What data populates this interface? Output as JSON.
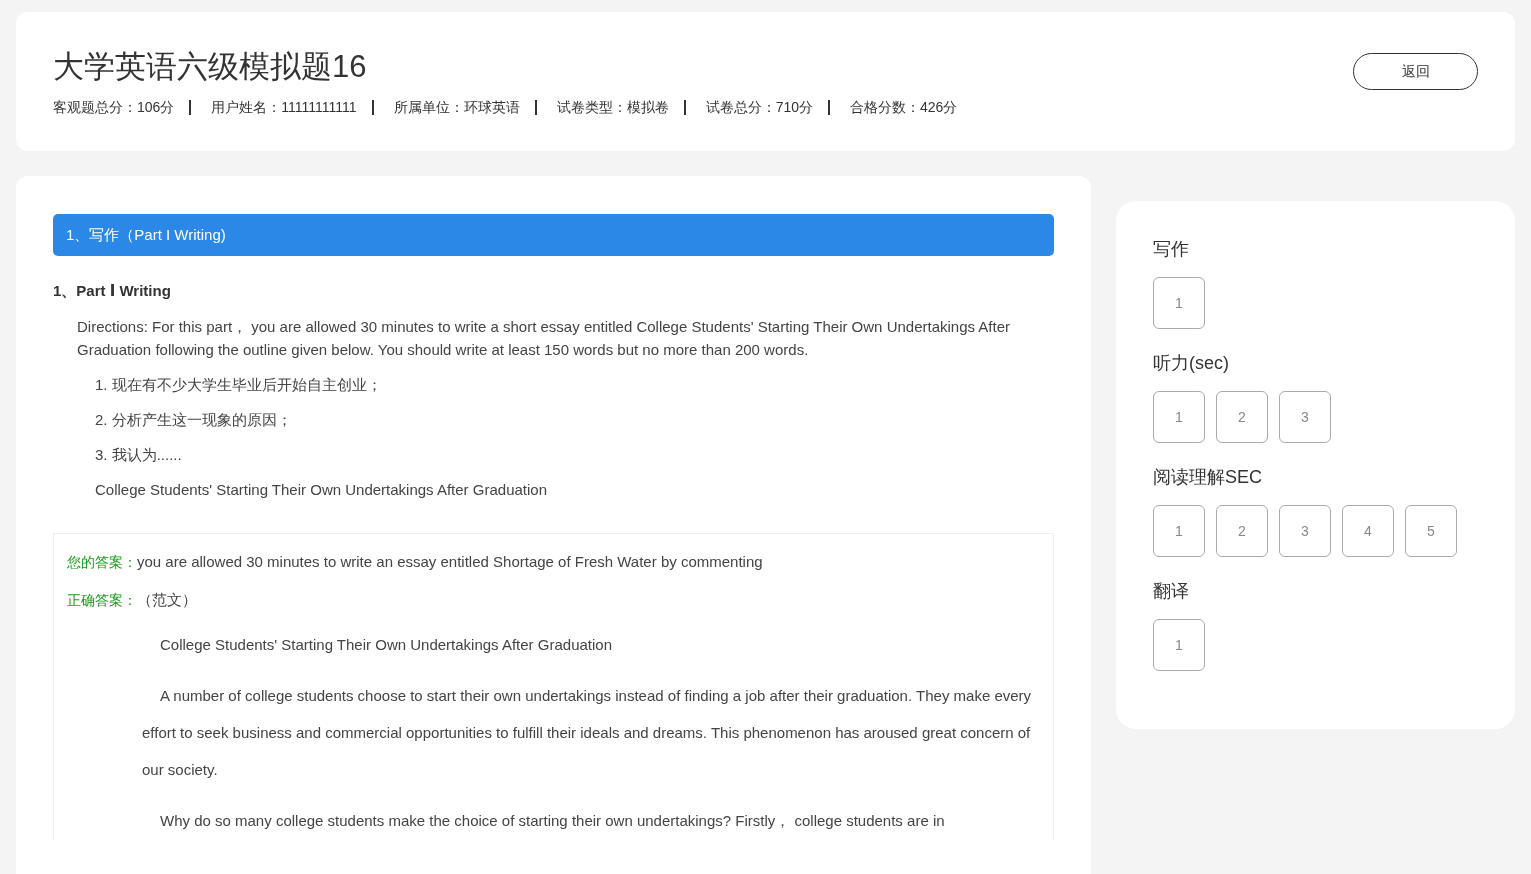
{
  "header": {
    "title": "大学英语六级模拟题16",
    "back_button": "返回",
    "info": [
      {
        "label": "客观题总分：",
        "value": "106分"
      },
      {
        "label": "用户姓名：",
        "value": "11111111111"
      },
      {
        "label": "所属单位：",
        "value": "环球英语"
      },
      {
        "label": "试卷类型：",
        "value": "模拟卷"
      },
      {
        "label": "试卷总分：",
        "value": "710分"
      },
      {
        "label": "合格分数：",
        "value": "426分"
      }
    ]
  },
  "section_bar": "1、写作（Part I Writing)",
  "question": {
    "number": "1、",
    "title": "Part Ⅰ Writing",
    "directions": "Directions: For this part， you are allowed 30 minutes to write a short essay entitled College Students' Starting Their Own Undertakings After Graduation following the outline given below. You should write at least 150 words but no more than 200 words.",
    "outline": [
      "1. 现在有不少大学生毕业后开始自主创业；",
      "2. 分析产生这一现象的原因；",
      "3. 我认为......",
      "College Students' Starting Their Own Undertakings After Graduation"
    ]
  },
  "answer": {
    "your_label": "您的答案：",
    "your_text": "you are allowed 30 minutes to write an essay entitled Shortage of Fresh Water by commenting",
    "correct_label": "正确答案：",
    "correct_text": "（范文）",
    "essay": [
      "College Students' Starting Their Own Undertakings After Graduation",
      "A number of college students choose to start their own undertakings instead of finding a job after their graduation. They make every effort to seek business and commercial opportunities to fulfill their ideals and dreams. This phenomenon has aroused great concern of our society.",
      "Why do so many college students make the choice of starting their own undertakings? Firstly， college students are in"
    ]
  },
  "navigator": [
    {
      "title": "写作",
      "items": [
        "1"
      ]
    },
    {
      "title": "听力(sec)",
      "items": [
        "1",
        "2",
        "3"
      ]
    },
    {
      "title": "阅读理解SEC",
      "items": [
        "1",
        "2",
        "3",
        "4",
        "5"
      ]
    },
    {
      "title": "翻译",
      "items": [
        "1"
      ]
    }
  ]
}
